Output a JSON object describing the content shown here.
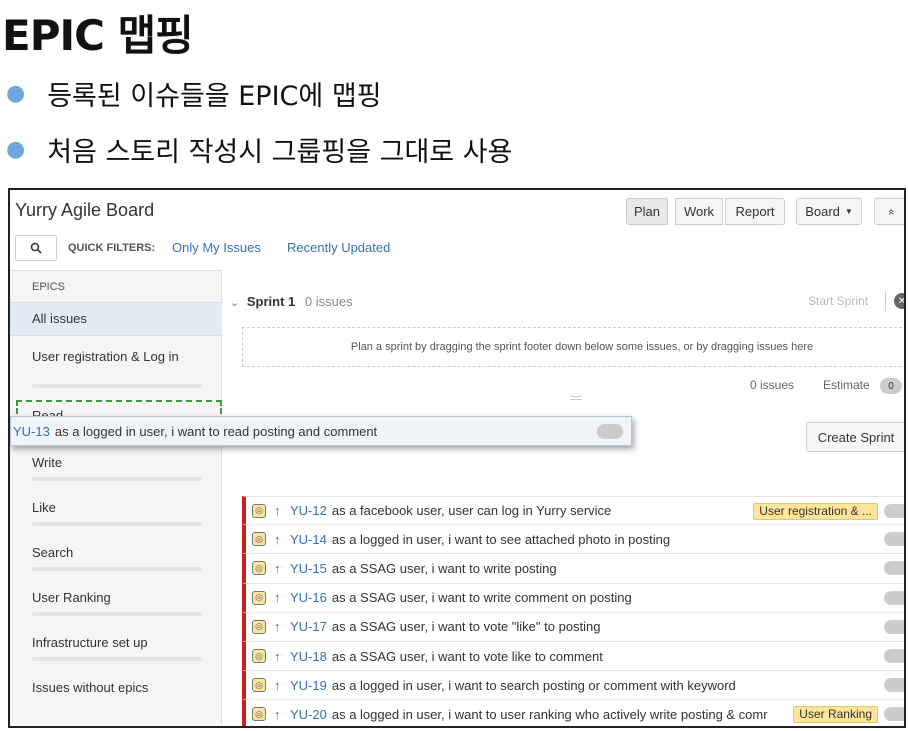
{
  "slide": {
    "title": "EPIC 맵핑",
    "bullets": [
      "등록된 이슈들을 EPIC에 맵핑",
      "처음 스토리 작성시 그룹핑을 그대로 사용"
    ]
  },
  "board": {
    "title": "Yurry Agile Board",
    "modes": [
      "Plan",
      "Work",
      "Report"
    ],
    "board_menu": "Board",
    "collapse_glyph": "«"
  },
  "filters": {
    "label": "QUICK FILTERS:",
    "items": [
      "Only My Issues",
      "Recently Updated"
    ]
  },
  "epics": {
    "heading": "EPICS",
    "items": [
      "All issues",
      "User registration & Log in",
      "Read",
      "Write",
      "Like",
      "Search",
      "User Ranking",
      "Infrastructure set up",
      "Issues without epics"
    ]
  },
  "sprint": {
    "name": "Sprint 1",
    "count": "0 issues",
    "start": "Start Sprint",
    "drop_hint": "Plan a sprint by dragging the sprint footer down below some issues, or by dragging issues here",
    "footer_issues": "0 issues",
    "estimate_label": "Estimate",
    "estimate_value": "0"
  },
  "dragging": {
    "key": "YU-13",
    "summary": "as a logged in user, i want to read posting and comment"
  },
  "create_sprint": "Create Sprint",
  "backlog": [
    {
      "key": "YU-12",
      "summary": "as a facebook user, user can log in Yurry service",
      "epic": "User registration & ..."
    },
    {
      "key": "YU-14",
      "summary": "as a logged in user, i want to see attached photo in posting",
      "epic": ""
    },
    {
      "key": "YU-15",
      "summary": "as a SSAG user, i want to write posting",
      "epic": ""
    },
    {
      "key": "YU-16",
      "summary": "as a SSAG user, i want to write comment on posting",
      "epic": ""
    },
    {
      "key": "YU-17",
      "summary": "as a SSAG user, i want to vote \"like\" to posting",
      "epic": ""
    },
    {
      "key": "YU-18",
      "summary": "as a SSAG user, i want to vote like to comment",
      "epic": ""
    },
    {
      "key": "YU-19",
      "summary": "as a logged in user, i want to search posting or comment with keyword",
      "epic": ""
    },
    {
      "key": "YU-20",
      "summary": "as a logged in user, i want to user ranking who actively write posting & comr",
      "epic": "User Ranking"
    }
  ],
  "colors": {
    "link": "#3572b0",
    "epic_label": "#ffe59a",
    "priority_high": "#d33333",
    "drop_target": "#3b9c3b"
  }
}
